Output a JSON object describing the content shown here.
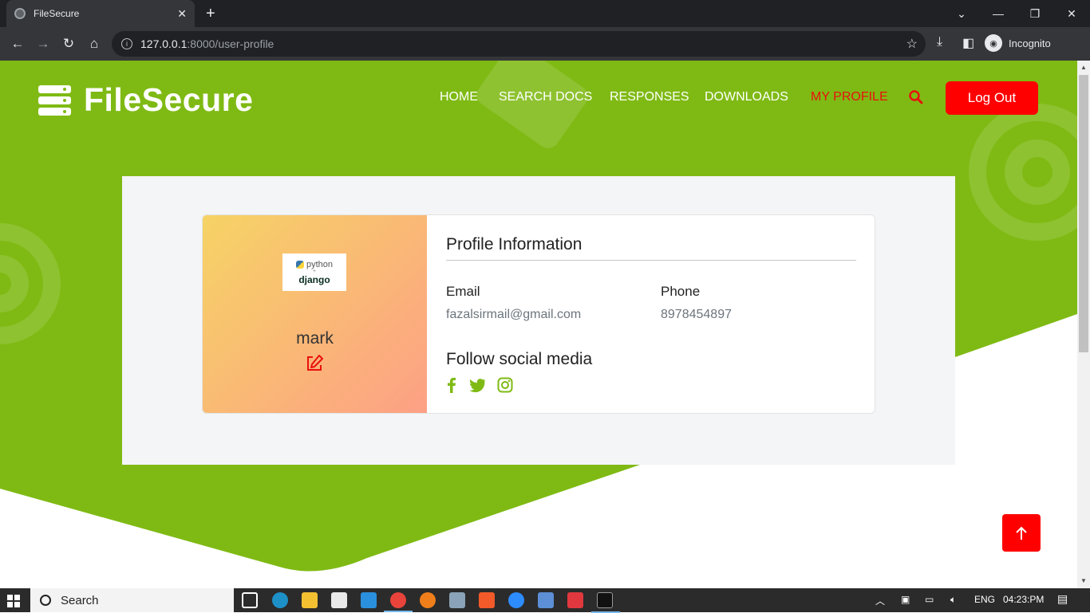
{
  "browser": {
    "tab_title": "FileSecure",
    "new_tab": "+",
    "url_host": "127.0.0.1",
    "url_path": ":8000/user-profile",
    "profile_label": "Incognito"
  },
  "site": {
    "brand": "FileSecure",
    "nav": [
      "HOME",
      "SEARCH DOCS",
      "RESPONSES",
      "DOWNLOADS",
      "MY PROFILE"
    ],
    "logout_label": "Log Out",
    "accent": "#7fba14",
    "active_color": "#e8110d"
  },
  "profile": {
    "image_text_top": "python",
    "image_text_plus": "+",
    "image_text_bottom": "django",
    "username": "mark",
    "section_title": "Profile Information",
    "email_label": "Email",
    "email_value": "fazalsirmail@gmail.com",
    "phone_label": "Phone",
    "phone_value": "8978454897",
    "social_title": "Follow social media",
    "social_icons": [
      "facebook-icon",
      "twitter-icon",
      "instagram-icon"
    ]
  },
  "taskbar": {
    "search_label": "Search",
    "language": "ENG",
    "time": "04:23:PM"
  }
}
